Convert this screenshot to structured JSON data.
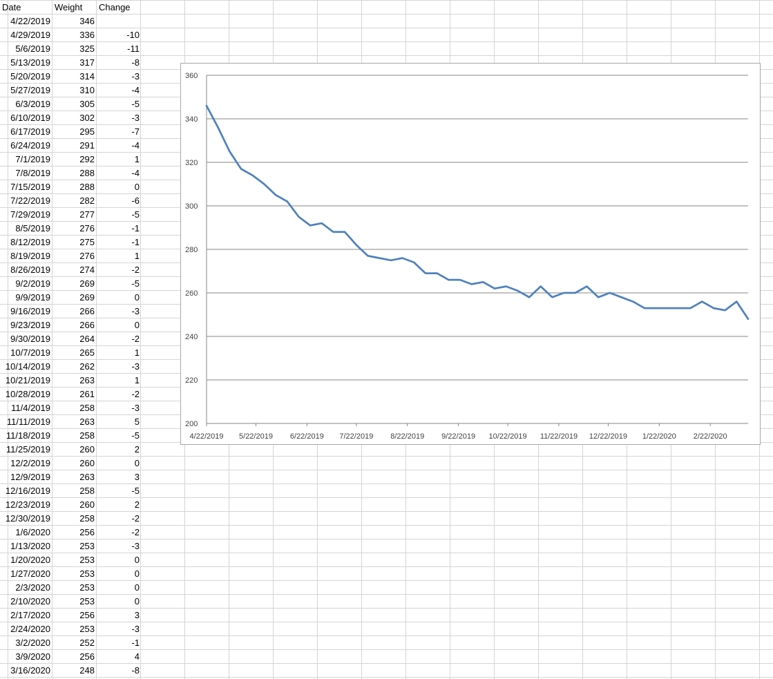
{
  "sheet": {
    "headers": {
      "date": "Date",
      "weight": "Weight",
      "change": "Change"
    },
    "rows": [
      {
        "date": "4/22/2019",
        "weight": "346",
        "change": ""
      },
      {
        "date": "4/29/2019",
        "weight": "336",
        "change": "-10"
      },
      {
        "date": "5/6/2019",
        "weight": "325",
        "change": "-11"
      },
      {
        "date": "5/13/2019",
        "weight": "317",
        "change": "-8"
      },
      {
        "date": "5/20/2019",
        "weight": "314",
        "change": "-3"
      },
      {
        "date": "5/27/2019",
        "weight": "310",
        "change": "-4"
      },
      {
        "date": "6/3/2019",
        "weight": "305",
        "change": "-5"
      },
      {
        "date": "6/10/2019",
        "weight": "302",
        "change": "-3"
      },
      {
        "date": "6/17/2019",
        "weight": "295",
        "change": "-7"
      },
      {
        "date": "6/24/2019",
        "weight": "291",
        "change": "-4"
      },
      {
        "date": "7/1/2019",
        "weight": "292",
        "change": "1"
      },
      {
        "date": "7/8/2019",
        "weight": "288",
        "change": "-4"
      },
      {
        "date": "7/15/2019",
        "weight": "288",
        "change": "0"
      },
      {
        "date": "7/22/2019",
        "weight": "282",
        "change": "-6"
      },
      {
        "date": "7/29/2019",
        "weight": "277",
        "change": "-5"
      },
      {
        "date": "8/5/2019",
        "weight": "276",
        "change": "-1"
      },
      {
        "date": "8/12/2019",
        "weight": "275",
        "change": "-1"
      },
      {
        "date": "8/19/2019",
        "weight": "276",
        "change": "1"
      },
      {
        "date": "8/26/2019",
        "weight": "274",
        "change": "-2"
      },
      {
        "date": "9/2/2019",
        "weight": "269",
        "change": "-5"
      },
      {
        "date": "9/9/2019",
        "weight": "269",
        "change": "0"
      },
      {
        "date": "9/16/2019",
        "weight": "266",
        "change": "-3"
      },
      {
        "date": "9/23/2019",
        "weight": "266",
        "change": "0"
      },
      {
        "date": "9/30/2019",
        "weight": "264",
        "change": "-2"
      },
      {
        "date": "10/7/2019",
        "weight": "265",
        "change": "1"
      },
      {
        "date": "10/14/2019",
        "weight": "262",
        "change": "-3"
      },
      {
        "date": "10/21/2019",
        "weight": "263",
        "change": "1"
      },
      {
        "date": "10/28/2019",
        "weight": "261",
        "change": "-2"
      },
      {
        "date": "11/4/2019",
        "weight": "258",
        "change": "-3"
      },
      {
        "date": "11/11/2019",
        "weight": "263",
        "change": "5"
      },
      {
        "date": "11/18/2019",
        "weight": "258",
        "change": "-5"
      },
      {
        "date": "11/25/2019",
        "weight": "260",
        "change": "2"
      },
      {
        "date": "12/2/2019",
        "weight": "260",
        "change": "0"
      },
      {
        "date": "12/9/2019",
        "weight": "263",
        "change": "3"
      },
      {
        "date": "12/16/2019",
        "weight": "258",
        "change": "-5"
      },
      {
        "date": "12/23/2019",
        "weight": "260",
        "change": "2"
      },
      {
        "date": "12/30/2019",
        "weight": "258",
        "change": "-2"
      },
      {
        "date": "1/6/2020",
        "weight": "256",
        "change": "-2"
      },
      {
        "date": "1/13/2020",
        "weight": "253",
        "change": "-3"
      },
      {
        "date": "1/20/2020",
        "weight": "253",
        "change": "0"
      },
      {
        "date": "1/27/2020",
        "weight": "253",
        "change": "0"
      },
      {
        "date": "2/3/2020",
        "weight": "253",
        "change": "0"
      },
      {
        "date": "2/10/2020",
        "weight": "253",
        "change": "0"
      },
      {
        "date": "2/17/2020",
        "weight": "256",
        "change": "3"
      },
      {
        "date": "2/24/2020",
        "weight": "253",
        "change": "-3"
      },
      {
        "date": "3/2/2020",
        "weight": "252",
        "change": "-1"
      },
      {
        "date": "3/9/2020",
        "weight": "256",
        "change": "4"
      },
      {
        "date": "3/16/2020",
        "weight": "248",
        "change": "-8"
      }
    ]
  },
  "colors": {
    "line": "#4f81bd",
    "gridline": "#858585",
    "axis": "#858585",
    "cell_grid": "#d4d4d4"
  },
  "chart_data": {
    "type": "line",
    "title": "",
    "xlabel": "",
    "ylabel": "",
    "ylim": [
      200,
      360
    ],
    "y_ticks": [
      "200",
      "220",
      "240",
      "260",
      "280",
      "300",
      "320",
      "340",
      "360"
    ],
    "x_ticks": [
      "4/22/2019",
      "5/22/2019",
      "6/22/2019",
      "7/22/2019",
      "8/22/2019",
      "9/22/2019",
      "10/22/2019",
      "11/22/2019",
      "12/22/2019",
      "1/22/2020",
      "2/22/2020"
    ],
    "x_range": [
      "2019-04-22",
      "2020-03-16"
    ],
    "grid": true,
    "legend": "none",
    "series": [
      {
        "x": [
          "2019-04-22",
          "2019-04-29",
          "2019-05-06",
          "2019-05-13",
          "2019-05-20",
          "2019-05-27",
          "2019-06-03",
          "2019-06-10",
          "2019-06-17",
          "2019-06-24",
          "2019-07-01",
          "2019-07-08",
          "2019-07-15",
          "2019-07-22",
          "2019-07-29",
          "2019-08-05",
          "2019-08-12",
          "2019-08-19",
          "2019-08-26",
          "2019-09-02",
          "2019-09-09",
          "2019-09-16",
          "2019-09-23",
          "2019-09-30",
          "2019-10-07",
          "2019-10-14",
          "2019-10-21",
          "2019-10-28",
          "2019-11-04",
          "2019-11-11",
          "2019-11-18",
          "2019-11-25",
          "2019-12-02",
          "2019-12-09",
          "2019-12-16",
          "2019-12-23",
          "2019-12-30",
          "2020-01-06",
          "2020-01-13",
          "2020-01-20",
          "2020-01-27",
          "2020-02-03",
          "2020-02-10",
          "2020-02-17",
          "2020-02-24",
          "2020-03-02",
          "2020-03-09",
          "2020-03-16"
        ],
        "values": [
          346,
          336,
          325,
          317,
          314,
          310,
          305,
          302,
          295,
          291,
          292,
          288,
          288,
          282,
          277,
          276,
          275,
          276,
          274,
          269,
          269,
          266,
          266,
          264,
          265,
          262,
          263,
          261,
          258,
          263,
          258,
          260,
          260,
          263,
          258,
          260,
          258,
          256,
          253,
          253,
          253,
          253,
          253,
          256,
          253,
          252,
          256,
          248
        ]
      }
    ]
  }
}
